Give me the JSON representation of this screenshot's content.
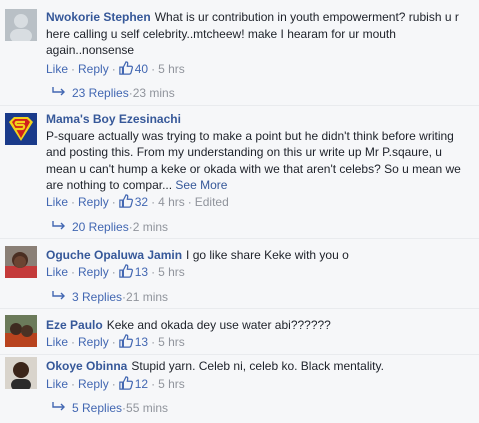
{
  "comments": [
    {
      "author": "Nwokorie Stephen",
      "text": "What is ur contribution in youth empowerment? rubish u r here calling u self celebrity..mtcheew! make I hearam for ur mouth again..nonsense",
      "like": "Like",
      "reply": "Reply",
      "likes": "40",
      "time": "5 hrs",
      "replies": "23 Replies",
      "replies_time": "23 mins"
    },
    {
      "author": "Mama's Boy Ezesinachi",
      "text": "P-square actually was trying to make a point but he didn't think before writing and posting this. From my understanding on this ur write up Mr P.sqaure, u mean u can't hump a keke or okada with we that aren't celebs? So u mean we are nothing to compar...",
      "see_more": "See More",
      "like": "Like",
      "reply": "Reply",
      "likes": "32",
      "time": "4 hrs",
      "edited": "Edited",
      "replies": "20 Replies",
      "replies_time": "2 mins"
    },
    {
      "author": "Oguche Opaluwa Jamin",
      "text": "I go like share Keke with you o",
      "like": "Like",
      "reply": "Reply",
      "likes": "13",
      "time": "5 hrs",
      "replies": "3 Replies",
      "replies_time": "21 mins"
    },
    {
      "author": "Eze Paulo",
      "text": "Keke and okada dey use water abi??????",
      "like": "Like",
      "reply": "Reply",
      "likes": "13",
      "time": "5 hrs"
    },
    {
      "author": "Okoye Obinna",
      "text": "Stupid yarn. Celeb ni, celeb ko. Black mentality.",
      "like": "Like",
      "reply": "Reply",
      "likes": "12",
      "time": "5 hrs",
      "replies": "5 Replies",
      "replies_time": "55 mins"
    }
  ],
  "colors": {
    "link": "#365899",
    "action": "#4267b2",
    "meta": "#90949c"
  },
  "icons": [
    "thumbs-up-icon",
    "reply-arrow-icon"
  ]
}
